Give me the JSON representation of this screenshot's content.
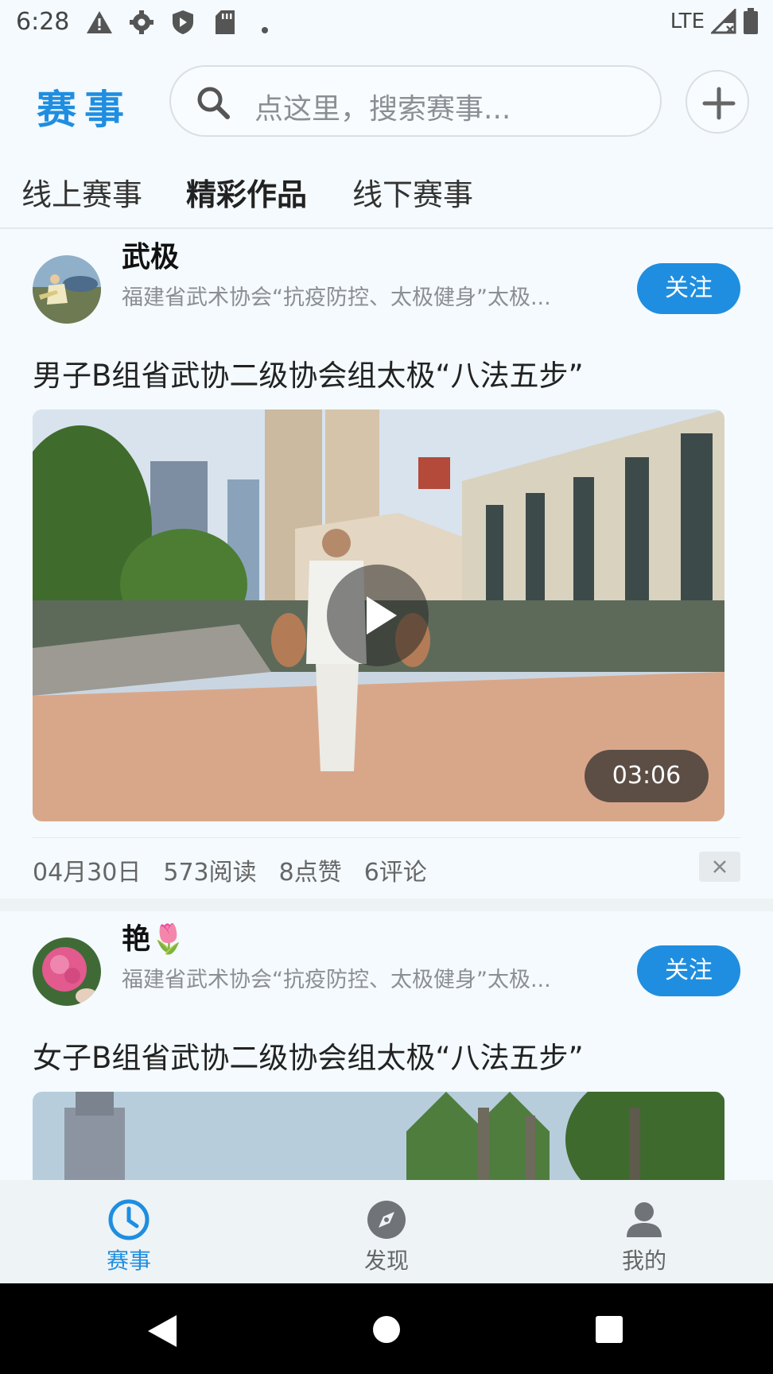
{
  "status_bar": {
    "time": "6:28",
    "network": "LTE"
  },
  "header": {
    "title": "赛事",
    "search_placeholder": "点这里，搜索赛事..."
  },
  "tabs": [
    {
      "label": "线上赛事",
      "active": false
    },
    {
      "label": "精彩作品",
      "active": true
    },
    {
      "label": "线下赛事",
      "active": false
    }
  ],
  "posts": [
    {
      "username": "武极",
      "subtitle": "福建省武术协会“抗疫防控、太极健身”太极...",
      "follow_label": "关注",
      "title": "男子B组省武协二级协会组太极“八法五步”",
      "duration": "03:06",
      "date": "04月30日",
      "reads": "573阅读",
      "likes": "8点赞",
      "comments": "6评论"
    },
    {
      "username": "艳🌷",
      "subtitle": "福建省武术协会“抗疫防控、太极健身”太极...",
      "follow_label": "关注",
      "title": "女子B组省武协二级协会组太极“八法五步”"
    }
  ],
  "bottom_nav": [
    {
      "label": "赛事",
      "icon": "clock-icon",
      "active": true
    },
    {
      "label": "发现",
      "icon": "compass-icon",
      "active": false
    },
    {
      "label": "我的",
      "icon": "person-icon",
      "active": false
    }
  ],
  "colors": {
    "accent": "#1f8ee0",
    "background": "#f4fafd"
  }
}
